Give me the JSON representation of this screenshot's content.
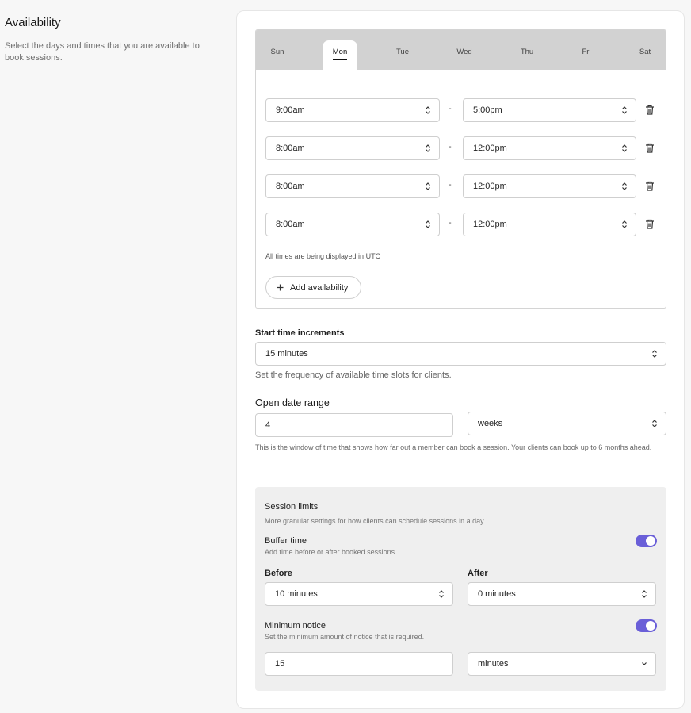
{
  "section": {
    "title": "Availability",
    "description": "Select the days and times that you are available to book sessions."
  },
  "days": {
    "tabs": [
      "Sun",
      "Mon",
      "Tue",
      "Wed",
      "Thu",
      "Fri",
      "Sat"
    ],
    "active": "Mon"
  },
  "slots": [
    {
      "start": "9:00am",
      "end": "5:00pm"
    },
    {
      "start": "8:00am",
      "end": "12:00pm"
    },
    {
      "start": "8:00am",
      "end": "12:00pm"
    },
    {
      "start": "8:00am",
      "end": "12:00pm"
    }
  ],
  "slot_separator": "-",
  "timezone_note": "All times are being displayed in UTC",
  "add_availability_label": "Add availability",
  "start_time_increments": {
    "label": "Start time increments",
    "value": "15 minutes",
    "help": "Set the frequency of available time slots for clients."
  },
  "open_date_range": {
    "label": "Open date range",
    "amount": "4",
    "unit": "weeks",
    "help": "This is the window of time that shows how far out a member can book a session. Your clients can book up to 6 months ahead."
  },
  "session_limits": {
    "title": "Session limits",
    "subtitle": "More granular settings for how clients can schedule sessions in a day.",
    "buffer_time": {
      "title": "Buffer time",
      "subtitle": "Add time before or after booked sessions.",
      "enabled": true,
      "before_label": "Before",
      "before_value": "10 minutes",
      "after_label": "After",
      "after_value": "0 minutes"
    },
    "minimum_notice": {
      "title": "Minimum notice",
      "subtitle": "Set the minimum amount of notice that is required.",
      "enabled": true,
      "amount": "15",
      "unit": "minutes"
    }
  },
  "colors": {
    "toggle_on": "#6a5fd8",
    "tabs_bg": "#d2d2d2"
  }
}
